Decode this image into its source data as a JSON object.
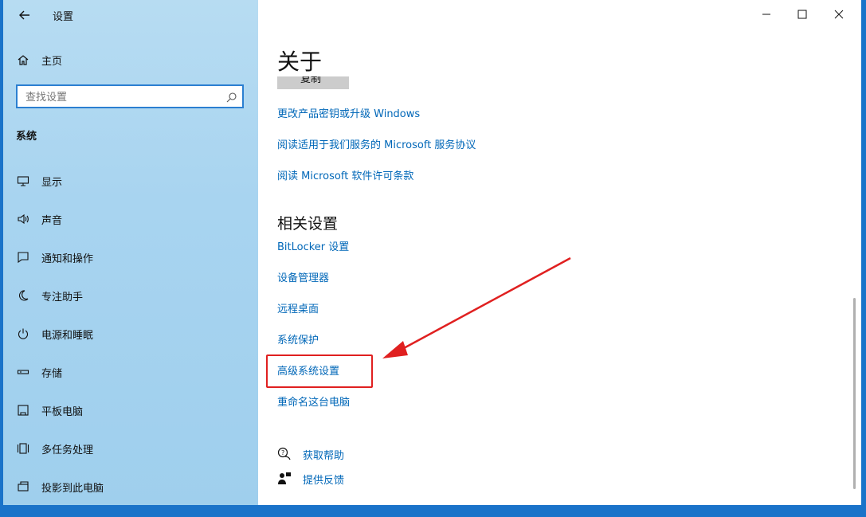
{
  "window": {
    "title": "设置"
  },
  "sidebar": {
    "home_label": "主页",
    "search_placeholder": "查找设置",
    "section_label": "系统",
    "items": [
      {
        "label": "显示",
        "icon": "monitor-icon"
      },
      {
        "label": "声音",
        "icon": "speaker-icon"
      },
      {
        "label": "通知和操作",
        "icon": "notification-icon"
      },
      {
        "label": "专注助手",
        "icon": "moon-icon"
      },
      {
        "label": "电源和睡眠",
        "icon": "power-icon"
      },
      {
        "label": "存储",
        "icon": "storage-icon"
      },
      {
        "label": "平板电脑",
        "icon": "tablet-icon"
      },
      {
        "label": "多任务处理",
        "icon": "multitask-icon"
      },
      {
        "label": "投影到此电脑",
        "icon": "project-icon"
      }
    ]
  },
  "main": {
    "title": "关于",
    "copy_button": "复制",
    "links": [
      "更改产品密钥或升级 Windows",
      "阅读适用于我们服务的 Microsoft 服务协议",
      "阅读 Microsoft 软件许可条款"
    ],
    "related_title": "相关设置",
    "related_links": [
      "BitLocker 设置",
      "设备管理器",
      "远程桌面",
      "系统保护",
      "高级系统设置",
      "重命名这台电脑"
    ],
    "help": [
      {
        "label": "获取帮助",
        "icon": "help-chat-icon"
      },
      {
        "label": "提供反馈",
        "icon": "feedback-icon"
      }
    ]
  },
  "colors": {
    "accent": "#0067b8",
    "highlight": "#e02020",
    "sidebar": "#a8d4f0"
  }
}
